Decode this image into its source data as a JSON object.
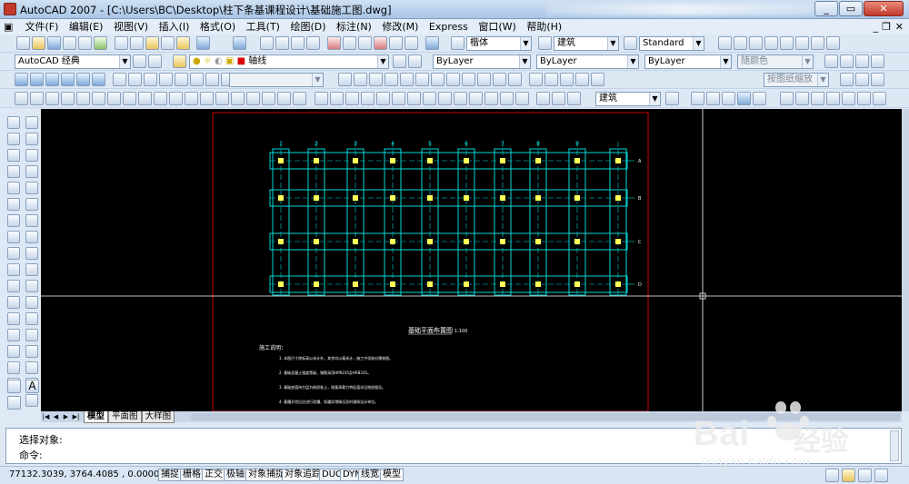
{
  "window": {
    "title": "AutoCAD 2007 - [C:\\Users\\BC\\Desktop\\柱下条基课程设计\\基础施工图.dwg]"
  },
  "menu": [
    "文件(F)",
    "编辑(E)",
    "视图(V)",
    "插入(I)",
    "格式(O)",
    "工具(T)",
    "绘图(D)",
    "标注(N)",
    "修改(M)",
    "Express",
    "窗口(W)",
    "帮助(H)"
  ],
  "toolbar": {
    "text_style": "楷体",
    "dim_style": "建筑",
    "table_style": "Standard",
    "workspace": "AutoCAD 经典",
    "layer": "轴线",
    "color": "ByLayer",
    "linetype": "ByLayer",
    "lineweight": "ByLayer",
    "plotstyle": "随颜色",
    "viewport_scale": "按图纸缩放",
    "dim_style2": "建筑"
  },
  "drawing": {
    "col_labels": [
      "1",
      "2",
      "3",
      "4",
      "5",
      "6",
      "7",
      "8",
      "9"
    ],
    "row_labels": [
      "A",
      "B",
      "C",
      "D"
    ],
    "plan_title": "基础平面布置图",
    "plan_scale": "1:100",
    "notes_title": "施工说明：",
    "notes": [
      "1. 本图尺寸除标高以米计外，其余均以毫米计，施工中须核对建筑图。",
      "2. 基础混凝土强度等级，钢筋采用HPB235及HRB335。",
      "3. 基础底面持力层为粉质粘土，地基承载力特征值详见地质报告。",
      "4. 基槽开挖后应进行验槽，如遇异常情况及时通知设计单位。"
    ]
  },
  "layout_tabs": [
    "模型",
    "平面图",
    "大样图"
  ],
  "command": {
    "line1": "选择对象:",
    "line2": "命令:"
  },
  "status": {
    "coords": "77132.3039,  3764.4085 , 0.0000",
    "toggles": [
      "捕捉",
      "栅格",
      "正交",
      "极轴",
      "对象捕捉",
      "对象追踪",
      "DUCS",
      "DYN",
      "线宽",
      "模型"
    ]
  },
  "watermark": {
    "brand": "Bai",
    "brand_tail": "经验",
    "url": "jingyan.baidu.com"
  },
  "colors": {
    "canvas": "#000000",
    "grid": "#00d7d7",
    "frame": "#cc0000",
    "crosshair": "#ffffff",
    "accent": "#ffff55"
  }
}
